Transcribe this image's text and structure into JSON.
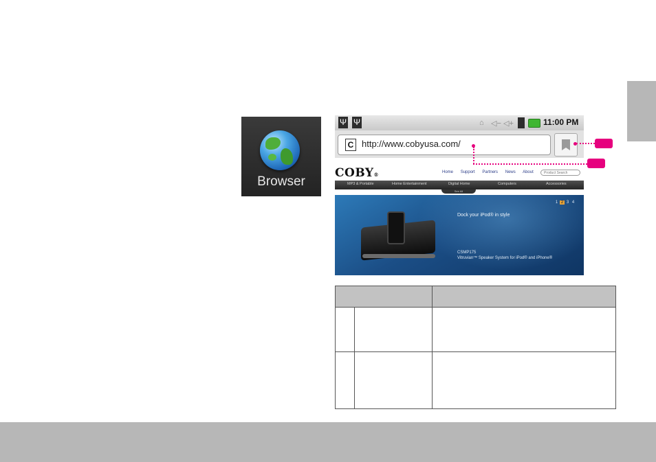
{
  "app_icon": {
    "label": "Browser",
    "icon": "globe-icon"
  },
  "status_bar": {
    "time": "11:00 PM",
    "battery_color": "#3fb631"
  },
  "address_bar": {
    "url": "http://www.cobyusa.com/",
    "favicon_letter": "C"
  },
  "website": {
    "logo": "COBY",
    "logo_mark": "®",
    "top_links": [
      "Home",
      "Support",
      "Partners",
      "News",
      "About"
    ],
    "search_placeholder": "Product Search",
    "nav_items": [
      "MP3 & Portable",
      "Home Entertainment",
      "Digital Home",
      "Computers",
      "Accessories"
    ],
    "see_all": "See All",
    "hero": {
      "tagline": "Dock your iPod® in style",
      "model": "CSMP175",
      "product": "Vitruvian™ Speaker System for iPod® and iPhone®",
      "pager": [
        "1",
        "2",
        "3",
        "4"
      ],
      "active_page": "2"
    }
  },
  "accent_color": "#e6007e",
  "table": {
    "header": [
      "",
      ""
    ],
    "rows": [
      [
        "",
        "",
        ""
      ],
      [
        "",
        "",
        ""
      ]
    ]
  }
}
